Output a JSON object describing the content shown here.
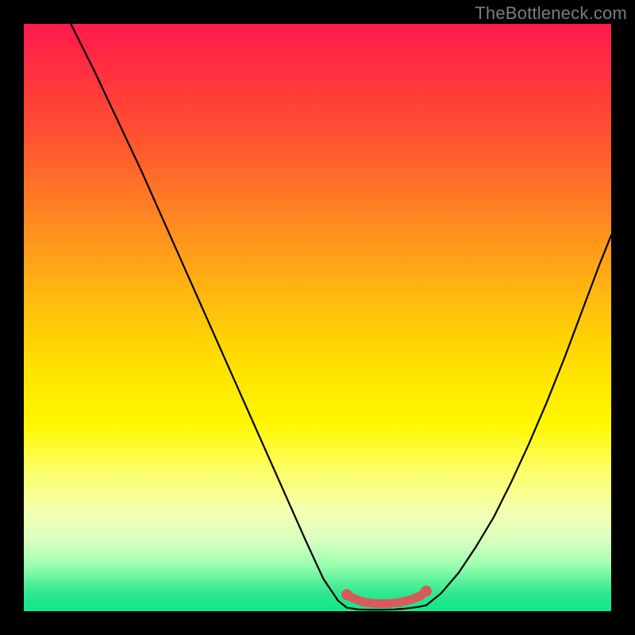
{
  "watermark": "TheBottleneck.com",
  "chart_data": {
    "type": "line",
    "title": "",
    "xlabel": "",
    "ylabel": "",
    "xlim": [
      0,
      100
    ],
    "ylim": [
      0,
      100
    ],
    "grid": false,
    "series": [
      {
        "name": "left-curve",
        "x": [
          8,
          12,
          16,
          20,
          24,
          28,
          32,
          36,
          40,
          44,
          48,
          51,
          53.5,
          55
        ],
        "values": [
          100,
          92,
          83.5,
          75,
          66,
          57,
          48,
          39,
          30,
          21,
          12,
          5.5,
          1.8,
          0.6
        ]
      },
      {
        "name": "flat-bottom",
        "x": [
          55,
          57,
          59,
          61,
          63,
          65,
          67,
          68.5
        ],
        "values": [
          0.6,
          0.3,
          0.25,
          0.25,
          0.3,
          0.45,
          0.7,
          1.0
        ]
      },
      {
        "name": "right-curve",
        "x": [
          68.5,
          71,
          74,
          77,
          80,
          83,
          86,
          89,
          92,
          95,
          98,
          100
        ],
        "values": [
          1.0,
          3.0,
          6.5,
          11,
          16,
          22,
          28.5,
          35.5,
          43,
          51,
          59,
          64
        ]
      },
      {
        "name": "marker-segment",
        "x": [
          55,
          56.5,
          58,
          60,
          62,
          64,
          66,
          67.5,
          68.5
        ],
        "values": [
          2.8,
          2.0,
          1.5,
          1.3,
          1.3,
          1.5,
          2.0,
          2.6,
          3.4
        ]
      }
    ],
    "marker_color": "#d85a5a",
    "curve_color": "#000000"
  }
}
